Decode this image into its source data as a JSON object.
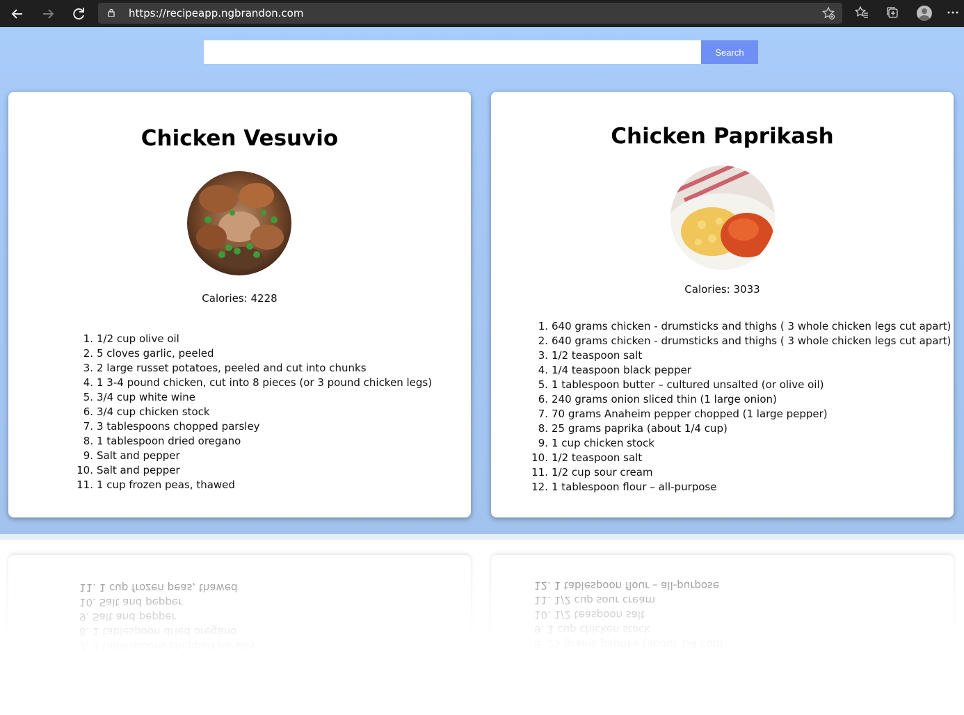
{
  "browser": {
    "url": "https://recipeapp.ngbrandon.com",
    "icons": [
      "back-icon",
      "forward-icon",
      "refresh-icon",
      "lock-icon",
      "add-favorite-icon",
      "favorites-icon",
      "collections-icon",
      "profile-icon",
      "more-icon"
    ]
  },
  "search": {
    "placeholder": "",
    "button_label": "Search"
  },
  "colors": {
    "page_background": "#a6c8f6",
    "search_button": "#6f8ff5"
  },
  "recipes": [
    {
      "title": "Chicken Vesuvio",
      "calories": "Calories: 4228",
      "ingredients": [
        "1/2 cup olive oil",
        "5 cloves garlic, peeled",
        "2 large russet potatoes, peeled and cut into chunks",
        "1 3-4 pound chicken, cut into 8 pieces (or 3 pound chicken legs)",
        "3/4 cup white wine",
        "3/4 cup chicken stock",
        "3 tablespoons chopped parsley",
        "1 tablespoon dried oregano",
        "Salt and pepper",
        "Salt and pepper",
        "1 cup frozen peas, thawed"
      ]
    },
    {
      "title": "Chicken Paprikash",
      "calories": "Calories: 3033",
      "ingredients": [
        "640 grams chicken - drumsticks and thighs ( 3 whole chicken legs cut apart)",
        "640 grams chicken - drumsticks and thighs ( 3 whole chicken legs cut apart)",
        "1/2 teaspoon salt",
        "1/4 teaspoon black pepper",
        "1 tablespoon butter – cultured unsalted (or olive oil)",
        "240 grams onion sliced thin (1 large onion)",
        "70 grams Anaheim pepper chopped (1 large pepper)",
        "25 grams paprika (about 1/4 cup)",
        "1 cup chicken stock",
        "1/2 teaspoon salt",
        "1/2 cup sour cream",
        "1 tablespoon flour – all-purpose"
      ]
    }
  ]
}
